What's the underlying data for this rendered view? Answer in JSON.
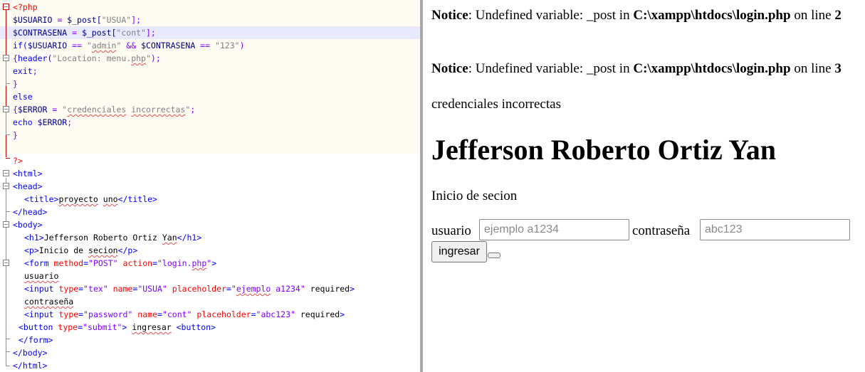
{
  "editor": {
    "php_open": "<?php",
    "php_close": "?>",
    "l2": {
      "var": "$USUARIO",
      "eq": " = ",
      "func": "$_post[",
      "str": "\"USUA\"",
      "end": "];"
    },
    "l3": {
      "var": "$CONTRASENA",
      "eq": " = ",
      "func": "$_post[",
      "str": "\"cont\"",
      "end": "];"
    },
    "l4": {
      "kw": "if(",
      "v1": "$USUARIO",
      "op1": " == ",
      "q1": "\"",
      "s1": "admin",
      "q1b": "\"",
      "and": " && ",
      "v2": "$CONTRASENA",
      "op2": " == ",
      "s2": "\"123\"",
      "close": ")"
    },
    "l5": {
      "open": "{",
      "kw": "header(",
      "q": "\"Location: menu.",
      "w": "php",
      "qe": "\"",
      "end": ");"
    },
    "l6": {
      "kw": "exit",
      "end": ";"
    },
    "l7": "}",
    "l8": "else",
    "l9": {
      "open": "{",
      "var": "$ERROR",
      "eq": " = ",
      "q": "\"",
      "w1": "credenciales",
      "sp": " ",
      "w2": "incorrectas",
      "qe": "\"",
      "end": ";"
    },
    "l10": {
      "kw": "echo",
      "sp": " ",
      "var": "$ERROR",
      "end": ";"
    },
    "l11": "}",
    "html_open": "<html>",
    "head_open": "<head>",
    "title": {
      "open": "<title>",
      "w1": "proyecto",
      "sp": " ",
      "w2": "uno",
      "close": "</title>"
    },
    "head_close": "</head>",
    "body_open": "<body>",
    "h1": {
      "open": "<h1>",
      "text": "Jefferson Roberto Ortiz ",
      "w": "Yan",
      "close": "</h1>"
    },
    "p": {
      "open": "<p>",
      "text": "Inicio de ",
      "w": "secion",
      "close": "</p>"
    },
    "form": {
      "open": "<form ",
      "a1": "method",
      "eq1": "=",
      "v1": "\"POST\"",
      "sp": " ",
      "a2": "action",
      "eq2": "=",
      "v2a": "\"login.",
      "v2w": "php",
      "v2b": "\"",
      "close": ">"
    },
    "usuario": "usuario",
    "input1": {
      "open": "<input ",
      "a1": "type",
      "eq": "=",
      "v1": "\"tex\"",
      "a2": "name",
      "v2": "\"USUA\"",
      "a3": "placeholder",
      "v3a": "\"",
      "v3w": "ejemplo",
      "v3b": " a1234\"",
      "req": " required",
      "close": ">"
    },
    "contrasena": "contraseña",
    "input2": {
      "open": "<input ",
      "a1": "type",
      "eq": "=",
      "v1": "\"password\"",
      "a2": "name",
      "v2": "\"cont\"",
      "a3": "placeholder",
      "v3": "\"abc123\"",
      "req": " required",
      "close": ">"
    },
    "button": {
      "open": "<button ",
      "a1": "type",
      "eq": "=",
      "v1": "\"submit\"",
      "close": ">",
      "sp": " ",
      "w": "ingresar",
      "sp2": " ",
      "tag": "<button>"
    },
    "form_close": "</form>",
    "body_close": "</body>",
    "html_close": "</html>"
  },
  "browser": {
    "notice1": {
      "label": "Notice",
      "msg": ": Undefined variable: _post in ",
      "path": "C:\\xampp\\htdocs\\login.php",
      "on": " on line ",
      "line": "2"
    },
    "notice2": {
      "label": "Notice",
      "msg": ": Undefined variable: _post in ",
      "path": "C:\\xampp\\htdocs\\login.php",
      "on": " on line ",
      "line": "3"
    },
    "error_text": "credenciales incorrectas",
    "heading": "Jefferson Roberto Ortiz Yan",
    "intro": "Inicio de secion",
    "user_label": "usuario",
    "user_placeholder": "ejemplo a1234",
    "pass_label": "contraseña",
    "pass_placeholder": "abc123",
    "submit_label": "ingresar"
  }
}
